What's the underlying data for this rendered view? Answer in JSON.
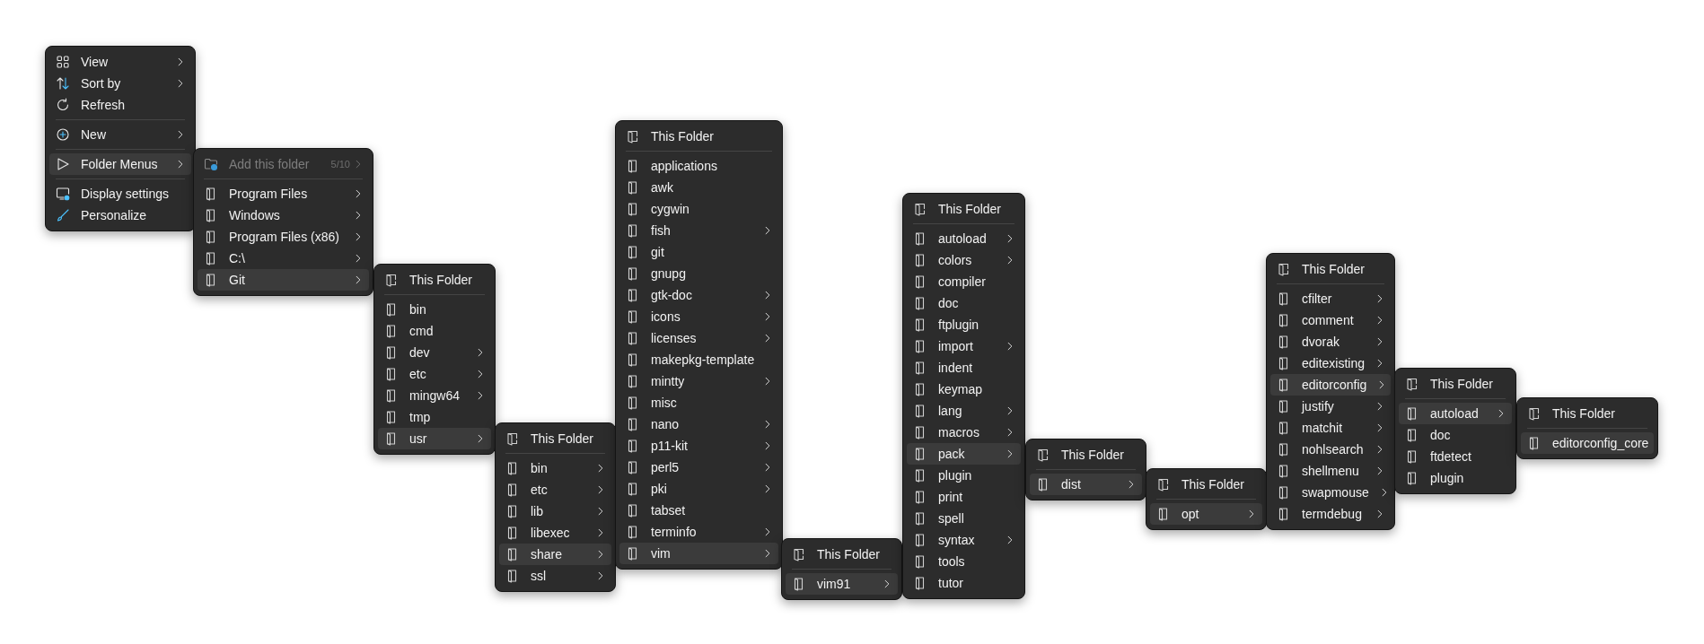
{
  "menus": [
    {
      "items": [
        {
          "kind": "item",
          "label": "View",
          "submenu": true,
          "selected": false
        },
        {
          "kind": "item",
          "label": "Sort by",
          "submenu": true,
          "selected": false
        },
        {
          "kind": "item",
          "label": "Refresh",
          "submenu": false,
          "selected": false
        },
        {
          "kind": "separator"
        },
        {
          "kind": "item",
          "label": "New",
          "submenu": true,
          "selected": false
        },
        {
          "kind": "separator"
        },
        {
          "kind": "item",
          "label": "Folder Menus",
          "submenu": true,
          "selected": true
        },
        {
          "kind": "separator"
        },
        {
          "kind": "item",
          "label": "Display settings",
          "submenu": false,
          "selected": false
        },
        {
          "kind": "item",
          "label": "Personalize",
          "submenu": false,
          "selected": false
        }
      ]
    },
    {
      "items": [
        {
          "kind": "add",
          "label": "Add this folder",
          "count": "5/10",
          "disabled": true,
          "submenu": true,
          "selected": false
        },
        {
          "kind": "separator"
        },
        {
          "kind": "folder",
          "label": "Program Files",
          "submenu": true,
          "selected": false
        },
        {
          "kind": "folder",
          "label": "Windows",
          "submenu": true,
          "selected": false
        },
        {
          "kind": "folder",
          "label": "Program Files (x86)",
          "submenu": true,
          "selected": false
        },
        {
          "kind": "folder",
          "label": "C:\\",
          "submenu": true,
          "selected": false
        },
        {
          "kind": "folder",
          "label": "Git",
          "submenu": true,
          "selected": true
        }
      ]
    },
    {
      "items": [
        {
          "kind": "this",
          "label": "This Folder",
          "submenu": false,
          "selected": false
        },
        {
          "kind": "separator"
        },
        {
          "kind": "folder",
          "label": "bin",
          "submenu": false,
          "selected": false
        },
        {
          "kind": "folder",
          "label": "cmd",
          "submenu": false,
          "selected": false
        },
        {
          "kind": "folder",
          "label": "dev",
          "submenu": true,
          "selected": false
        },
        {
          "kind": "folder",
          "label": "etc",
          "submenu": true,
          "selected": false
        },
        {
          "kind": "folder",
          "label": "mingw64",
          "submenu": true,
          "selected": false
        },
        {
          "kind": "folder",
          "label": "tmp",
          "submenu": false,
          "selected": false
        },
        {
          "kind": "folder",
          "label": "usr",
          "submenu": true,
          "selected": true
        }
      ]
    },
    {
      "items": [
        {
          "kind": "this",
          "label": "This Folder",
          "submenu": false,
          "selected": false
        },
        {
          "kind": "separator"
        },
        {
          "kind": "folder",
          "label": "bin",
          "submenu": true,
          "selected": false
        },
        {
          "kind": "folder",
          "label": "etc",
          "submenu": true,
          "selected": false
        },
        {
          "kind": "folder",
          "label": "lib",
          "submenu": true,
          "selected": false
        },
        {
          "kind": "folder",
          "label": "libexec",
          "submenu": true,
          "selected": false
        },
        {
          "kind": "folder",
          "label": "share",
          "submenu": true,
          "selected": true
        },
        {
          "kind": "folder",
          "label": "ssl",
          "submenu": true,
          "selected": false
        }
      ]
    },
    {
      "items": [
        {
          "kind": "this",
          "label": "This Folder",
          "submenu": false,
          "selected": false
        },
        {
          "kind": "separator"
        },
        {
          "kind": "folder",
          "label": "applications",
          "submenu": false,
          "selected": false
        },
        {
          "kind": "folder",
          "label": "awk",
          "submenu": false,
          "selected": false
        },
        {
          "kind": "folder",
          "label": "cygwin",
          "submenu": false,
          "selected": false
        },
        {
          "kind": "folder",
          "label": "fish",
          "submenu": true,
          "selected": false
        },
        {
          "kind": "folder",
          "label": "git",
          "submenu": false,
          "selected": false
        },
        {
          "kind": "folder",
          "label": "gnupg",
          "submenu": false,
          "selected": false
        },
        {
          "kind": "folder",
          "label": "gtk-doc",
          "submenu": true,
          "selected": false
        },
        {
          "kind": "folder",
          "label": "icons",
          "submenu": true,
          "selected": false
        },
        {
          "kind": "folder",
          "label": "licenses",
          "submenu": true,
          "selected": false
        },
        {
          "kind": "folder",
          "label": "makepkg-template",
          "submenu": false,
          "selected": false
        },
        {
          "kind": "folder",
          "label": "mintty",
          "submenu": true,
          "selected": false
        },
        {
          "kind": "folder",
          "label": "misc",
          "submenu": false,
          "selected": false
        },
        {
          "kind": "folder",
          "label": "nano",
          "submenu": true,
          "selected": false
        },
        {
          "kind": "folder",
          "label": "p11-kit",
          "submenu": true,
          "selected": false
        },
        {
          "kind": "folder",
          "label": "perl5",
          "submenu": true,
          "selected": false
        },
        {
          "kind": "folder",
          "label": "pki",
          "submenu": true,
          "selected": false
        },
        {
          "kind": "folder",
          "label": "tabset",
          "submenu": false,
          "selected": false
        },
        {
          "kind": "folder",
          "label": "terminfo",
          "submenu": true,
          "selected": false
        },
        {
          "kind": "folder",
          "label": "vim",
          "submenu": true,
          "selected": true
        }
      ]
    },
    {
      "items": [
        {
          "kind": "this",
          "label": "This Folder",
          "submenu": false,
          "selected": false
        },
        {
          "kind": "separator"
        },
        {
          "kind": "folder",
          "label": "vim91",
          "submenu": true,
          "selected": true
        }
      ]
    },
    {
      "items": [
        {
          "kind": "this",
          "label": "This Folder",
          "submenu": false,
          "selected": false
        },
        {
          "kind": "separator"
        },
        {
          "kind": "folder",
          "label": "autoload",
          "submenu": true,
          "selected": false
        },
        {
          "kind": "folder",
          "label": "colors",
          "submenu": true,
          "selected": false
        },
        {
          "kind": "folder",
          "label": "compiler",
          "submenu": false,
          "selected": false
        },
        {
          "kind": "folder",
          "label": "doc",
          "submenu": false,
          "selected": false
        },
        {
          "kind": "folder",
          "label": "ftplugin",
          "submenu": false,
          "selected": false
        },
        {
          "kind": "folder",
          "label": "import",
          "submenu": true,
          "selected": false
        },
        {
          "kind": "folder",
          "label": "indent",
          "submenu": false,
          "selected": false
        },
        {
          "kind": "folder",
          "label": "keymap",
          "submenu": false,
          "selected": false
        },
        {
          "kind": "folder",
          "label": "lang",
          "submenu": true,
          "selected": false
        },
        {
          "kind": "folder",
          "label": "macros",
          "submenu": true,
          "selected": false
        },
        {
          "kind": "folder",
          "label": "pack",
          "submenu": true,
          "selected": true
        },
        {
          "kind": "folder",
          "label": "plugin",
          "submenu": false,
          "selected": false
        },
        {
          "kind": "folder",
          "label": "print",
          "submenu": false,
          "selected": false
        },
        {
          "kind": "folder",
          "label": "spell",
          "submenu": false,
          "selected": false
        },
        {
          "kind": "folder",
          "label": "syntax",
          "submenu": true,
          "selected": false
        },
        {
          "kind": "folder",
          "label": "tools",
          "submenu": false,
          "selected": false
        },
        {
          "kind": "folder",
          "label": "tutor",
          "submenu": false,
          "selected": false
        }
      ]
    },
    {
      "items": [
        {
          "kind": "this",
          "label": "This Folder",
          "submenu": false,
          "selected": false
        },
        {
          "kind": "separator"
        },
        {
          "kind": "folder",
          "label": "dist",
          "submenu": true,
          "selected": true
        }
      ]
    },
    {
      "items": [
        {
          "kind": "this",
          "label": "This Folder",
          "submenu": false,
          "selected": false
        },
        {
          "kind": "separator"
        },
        {
          "kind": "folder",
          "label": "opt",
          "submenu": true,
          "selected": true
        }
      ]
    },
    {
      "items": [
        {
          "kind": "this",
          "label": "This Folder",
          "submenu": false,
          "selected": false
        },
        {
          "kind": "separator"
        },
        {
          "kind": "folder",
          "label": "cfilter",
          "submenu": true,
          "selected": false
        },
        {
          "kind": "folder",
          "label": "comment",
          "submenu": true,
          "selected": false
        },
        {
          "kind": "folder",
          "label": "dvorak",
          "submenu": true,
          "selected": false
        },
        {
          "kind": "folder",
          "label": "editexisting",
          "submenu": true,
          "selected": false
        },
        {
          "kind": "folder",
          "label": "editorconfig",
          "submenu": true,
          "selected": true
        },
        {
          "kind": "folder",
          "label": "justify",
          "submenu": true,
          "selected": false
        },
        {
          "kind": "folder",
          "label": "matchit",
          "submenu": true,
          "selected": false
        },
        {
          "kind": "folder",
          "label": "nohlsearch",
          "submenu": true,
          "selected": false
        },
        {
          "kind": "folder",
          "label": "shellmenu",
          "submenu": true,
          "selected": false
        },
        {
          "kind": "folder",
          "label": "swapmouse",
          "submenu": true,
          "selected": false
        },
        {
          "kind": "folder",
          "label": "termdebug",
          "submenu": true,
          "selected": false
        }
      ]
    },
    {
      "items": [
        {
          "kind": "this",
          "label": "This Folder",
          "submenu": false,
          "selected": false
        },
        {
          "kind": "separator"
        },
        {
          "kind": "folder",
          "label": "autoload",
          "submenu": true,
          "selected": true
        },
        {
          "kind": "folder",
          "label": "doc",
          "submenu": false,
          "selected": false
        },
        {
          "kind": "folder",
          "label": "ftdetect",
          "submenu": false,
          "selected": false
        },
        {
          "kind": "folder",
          "label": "plugin",
          "submenu": false,
          "selected": false
        }
      ]
    },
    {
      "items": [
        {
          "kind": "this",
          "label": "This Folder",
          "submenu": false,
          "selected": false
        },
        {
          "kind": "separator"
        },
        {
          "kind": "folder",
          "label": "editorconfig_core",
          "submenu": false,
          "selected": true
        }
      ]
    }
  ]
}
